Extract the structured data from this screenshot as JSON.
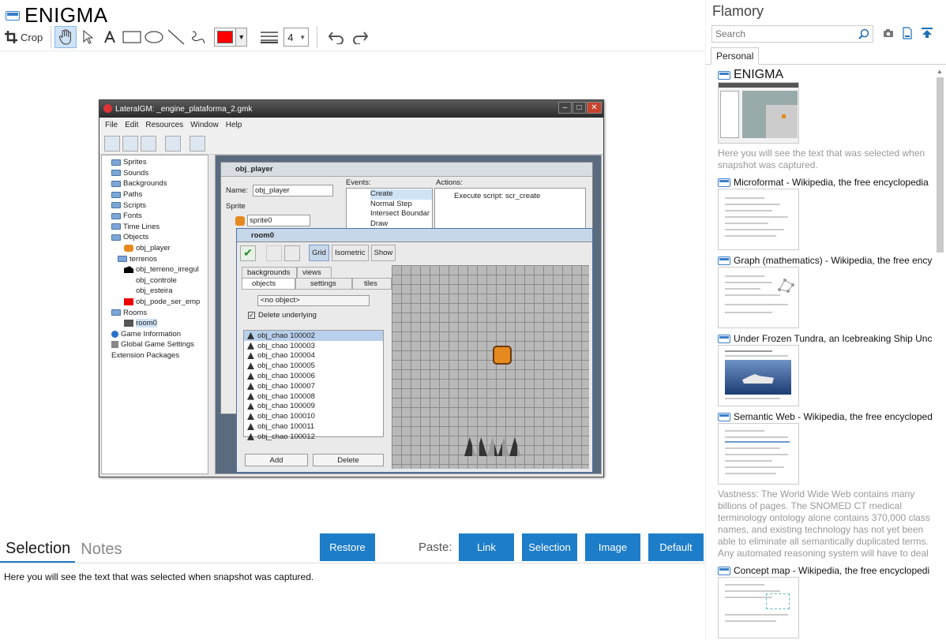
{
  "app": {
    "title": "ENIGMA"
  },
  "toolbar": {
    "crop_label": "Crop",
    "line_width": "4",
    "color": "#ff0000",
    "tools": [
      "crop-icon",
      "hand-icon",
      "pointer-icon",
      "text-icon",
      "rectangle-icon",
      "ellipse-icon",
      "line-icon",
      "freehand-icon",
      "color-picker",
      "line-width-icon",
      "undo-icon",
      "redo-icon"
    ]
  },
  "snapshot": {
    "window_title": "LateralGM: _engine_plataforma_2.gmk",
    "menu": [
      "File",
      "Edit",
      "Resources",
      "Window",
      "Help"
    ],
    "tree": [
      {
        "label": "Sprites",
        "type": "folder"
      },
      {
        "label": "Sounds",
        "type": "folder"
      },
      {
        "label": "Backgrounds",
        "type": "folder"
      },
      {
        "label": "Paths",
        "type": "folder"
      },
      {
        "label": "Scripts",
        "type": "folder"
      },
      {
        "label": "Fonts",
        "type": "folder"
      },
      {
        "label": "Time Lines",
        "type": "folder"
      },
      {
        "label": "Objects",
        "type": "folder"
      },
      {
        "label": "obj_player",
        "type": "item"
      },
      {
        "label": "terrenos",
        "type": "folder"
      },
      {
        "label": "obj_terreno_irregul",
        "type": "item"
      },
      {
        "label": "obj_controle",
        "type": "item"
      },
      {
        "label": "obj_esteira",
        "type": "item"
      },
      {
        "label": "obj_pode_ser_emp",
        "type": "item"
      },
      {
        "label": "Rooms",
        "type": "folder"
      },
      {
        "label": "room0",
        "type": "item"
      },
      {
        "label": "Game Information",
        "type": "item"
      },
      {
        "label": "Global Game Settings",
        "type": "item"
      },
      {
        "label": "Extension Packages",
        "type": "item"
      }
    ],
    "object_window": {
      "title": "obj_player",
      "name_label": "Name:",
      "name_value": "obj_player",
      "sprite_label": "Sprite",
      "sprite_value": "sprite0",
      "events_label": "Events:",
      "events": [
        "Create",
        "Normal Step",
        "Intersect Boundar",
        "Draw"
      ],
      "actions_label": "Actions:",
      "action": "Execute script: scr_create"
    },
    "room_window": {
      "title": "room0",
      "view_buttons": [
        "Grid",
        "Isometric",
        "Show"
      ],
      "tabs_top": [
        "backgrounds",
        "views"
      ],
      "tabs": [
        "objects",
        "settings",
        "tiles"
      ],
      "object_select": "<no object>",
      "delete_underlying": "Delete underlying",
      "instances": [
        "obj_chao 100002",
        "obj_chao 100003",
        "obj_chao 100004",
        "obj_chao 100005",
        "obj_chao 100006",
        "obj_chao 100007",
        "obj_chao 100008",
        "obj_chao 100009",
        "obj_chao 100010",
        "obj_chao 100011",
        "obj_chao 100012"
      ],
      "add_label": "Add",
      "delete_label": "Delete"
    }
  },
  "bottom": {
    "tabs": [
      "Selection",
      "Notes"
    ],
    "active_tab": "Selection",
    "restore_label": "Restore",
    "paste_label": "Paste:",
    "paste_buttons": [
      "Link",
      "Selection",
      "Image",
      "Default"
    ],
    "selection_text": "Here you will see the text that was selected when snapshot was captured."
  },
  "sidebar": {
    "title": "Flamory",
    "search_placeholder": "Search",
    "tab": "Personal",
    "items": [
      {
        "title": "ENIGMA",
        "desc": "Here you will see the text that was selected when snapshot was captured."
      },
      {
        "title": "Microformat - Wikipedia, the free encyclopedia",
        "desc": ""
      },
      {
        "title": "Graph (mathematics) - Wikipedia, the free ency",
        "desc": ""
      },
      {
        "title": "Under Frozen Tundra, an Icebreaking Ship Unco",
        "desc": ""
      },
      {
        "title": "Semantic Web - Wikipedia, the free encycloped",
        "desc": "Vastness: The World Wide Web contains many billions of pages. The SNOMED CT medical terminology ontology alone contains 370,000 class names, and existing technology has not yet been able to eliminate all semantically duplicated terms. Any automated reasoning system will have to deal with truly huge inputs."
      },
      {
        "title": "Concept map - Wikipedia, the free encyclopedi",
        "desc": ""
      }
    ]
  },
  "colors": {
    "accent": "#1e7dc8",
    "hand_active": "#cfe3f7"
  }
}
